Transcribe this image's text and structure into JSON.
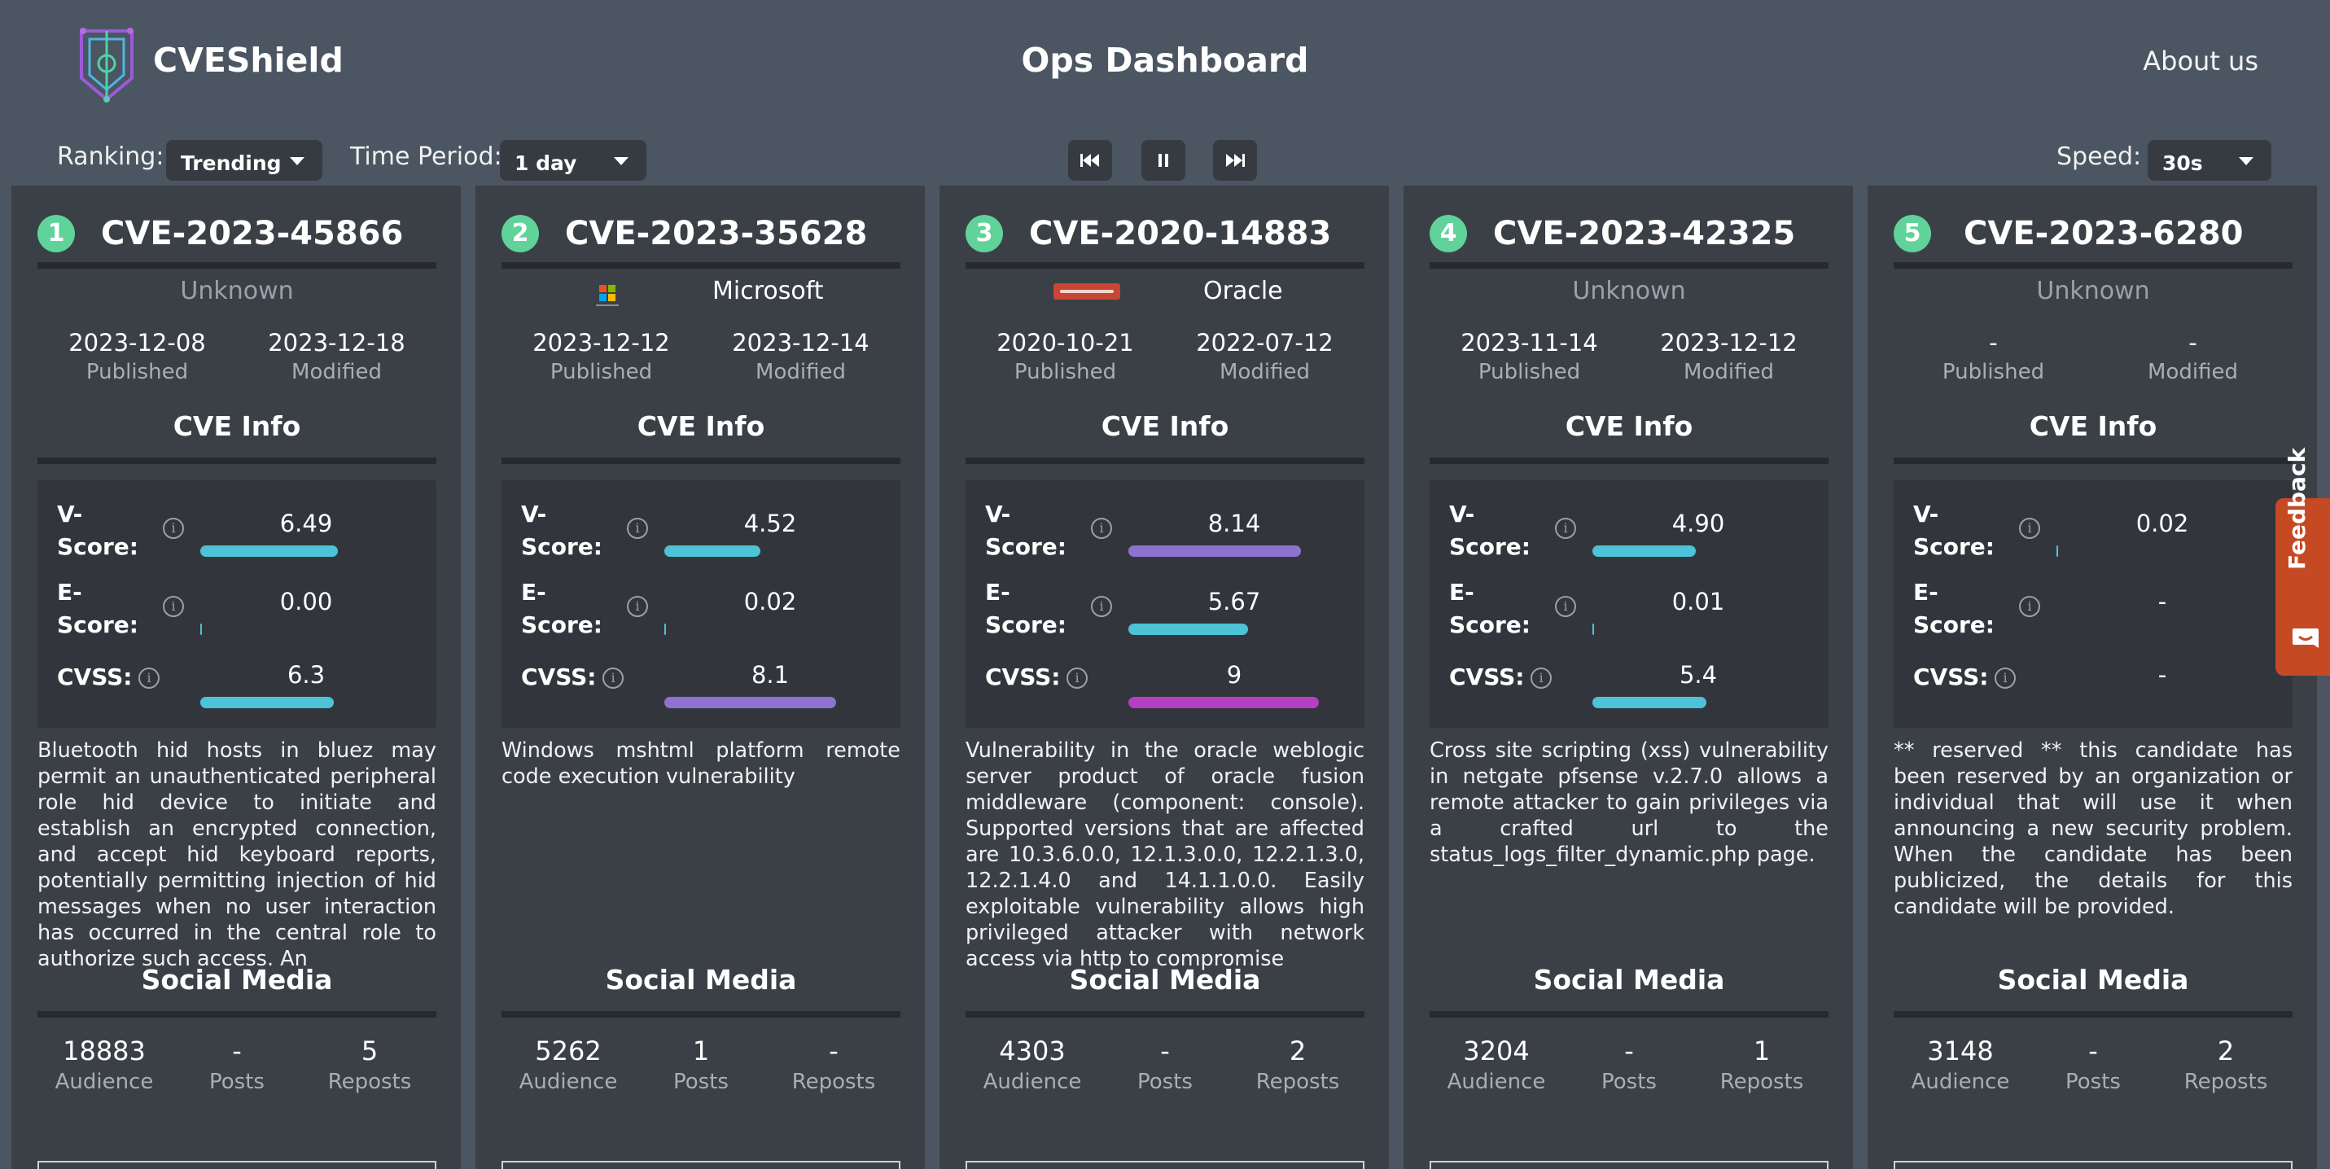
{
  "header": {
    "brand": "CVEShield",
    "title": "Ops Dashboard",
    "about": "About us"
  },
  "controls": {
    "ranking_label": "Ranking:",
    "ranking_value": "Trending",
    "period_label": "Time Period:",
    "period_value": "1 day",
    "speed_label": "Speed:",
    "speed_value": "30s"
  },
  "labels": {
    "published": "Published",
    "modified": "Modified",
    "cve_info": "CVE Info",
    "vscore_1": "V-",
    "vscore_2": "Score:",
    "escore_1": "E-",
    "escore_2": "Score:",
    "cvss": "CVSS:",
    "social_media": "Social Media",
    "audience": "Audience",
    "posts": "Posts",
    "reposts": "Reposts",
    "info_glyph": "i"
  },
  "cards": [
    {
      "rank": "1",
      "cve": "CVE-2023-45866",
      "vendor": "Unknown",
      "vendor_logo": "",
      "published": "2023-12-08",
      "modified": "2023-12-18",
      "vscore": "6.49",
      "vscore_frac": 0.649,
      "vscore_color": "#4cc3d6",
      "escore": "0.00",
      "escore_frac": 0.0,
      "escore_color": "#4cc3d6",
      "cvss": "6.3",
      "cvss_frac": 0.63,
      "cvss_color": "#4cc3d6",
      "description": "Bluetooth hid hosts in bluez may permit an unauthenticated peripheral role hid device to initiate and establish an encrypted connection, and accept hid keyboard reports, potentially permitting injection of hid messages when no user interaction has occurred in the central role to authorize such access. An",
      "audience": "18883",
      "posts": "-",
      "reposts": "5"
    },
    {
      "rank": "2",
      "cve": "CVE-2023-35628",
      "vendor": "Microsoft",
      "vendor_logo": "microsoft",
      "published": "2023-12-12",
      "modified": "2023-12-14",
      "vscore": "4.52",
      "vscore_frac": 0.452,
      "vscore_color": "#4cc3d6",
      "escore": "0.02",
      "escore_frac": 0.002,
      "escore_color": "#4cc3d6",
      "cvss": "8.1",
      "cvss_frac": 0.81,
      "cvss_color": "#8e72cf",
      "description": "Windows mshtml platform remote code execution vulnerability",
      "audience": "5262",
      "posts": "1",
      "reposts": "-"
    },
    {
      "rank": "3",
      "cve": "CVE-2020-14883",
      "vendor": "Oracle",
      "vendor_logo": "oracle",
      "published": "2020-10-21",
      "modified": "2022-07-12",
      "vscore": "8.14",
      "vscore_frac": 0.814,
      "vscore_color": "#8e72cf",
      "escore": "5.67",
      "escore_frac": 0.567,
      "escore_color": "#4cc3d6",
      "cvss": "9",
      "cvss_frac": 0.9,
      "cvss_color": "#b43fc1",
      "description": "Vulnerability in the oracle weblogic server product of oracle fusion middleware (component: console). Supported versions that are affected are 10.3.6.0.0, 12.1.3.0.0, 12.2.1.3.0, 12.2.1.4.0 and 14.1.1.0.0. Easily exploitable vulnerability allows high privileged attacker with network access via http to compromise",
      "audience": "4303",
      "posts": "-",
      "reposts": "2"
    },
    {
      "rank": "4",
      "cve": "CVE-2023-42325",
      "vendor": "Unknown",
      "vendor_logo": "",
      "published": "2023-11-14",
      "modified": "2023-12-12",
      "vscore": "4.90",
      "vscore_frac": 0.49,
      "vscore_color": "#4cc3d6",
      "escore": "0.01",
      "escore_frac": 0.001,
      "escore_color": "#4cc3d6",
      "cvss": "5.4",
      "cvss_frac": 0.54,
      "cvss_color": "#4cc3d6",
      "description": "Cross site scripting (xss) vulnerability in netgate pfsense v.2.7.0 allows a remote attacker to gain privileges via a crafted url to the status_logs_filter_dynamic.php page.",
      "audience": "3204",
      "posts": "-",
      "reposts": "1"
    },
    {
      "rank": "5",
      "cve": "CVE-2023-6280",
      "vendor": "Unknown",
      "vendor_logo": "",
      "published": "-",
      "modified": "-",
      "vscore": "0.02",
      "vscore_frac": 0.002,
      "vscore_color": "#4cc3d6",
      "escore": "-",
      "escore_frac": null,
      "escore_color": "#4cc3d6",
      "cvss": "-",
      "cvss_frac": null,
      "cvss_color": "#4cc3d6",
      "description": "** reserved ** this candidate has been reserved by an organization or individual that will use it when announcing a new security problem. When the candidate has been publicized, the details for this candidate will be provided.",
      "audience": "3148",
      "posts": "-",
      "reposts": "2"
    }
  ],
  "feedback": {
    "label": "Feedback"
  },
  "colors": {
    "accent_green": "#5fd39a",
    "bar_cyan": "#4cc3d6",
    "bar_purple": "#8e72cf",
    "bar_magenta": "#b43fc1",
    "feedback": "#c54a24"
  }
}
